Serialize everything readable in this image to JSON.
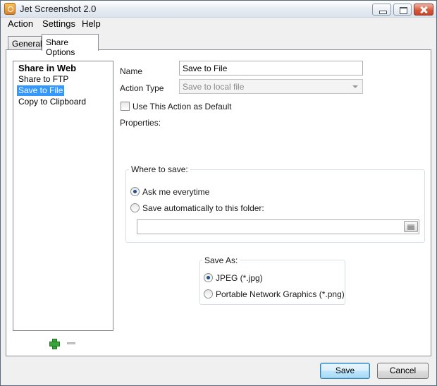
{
  "window": {
    "title": "Jet Screenshot 2.0"
  },
  "menu": [
    "Action",
    "Settings",
    "Help"
  ],
  "tabs": [
    "General",
    "Share Options"
  ],
  "actions": {
    "group_label": "Share in Web",
    "items": [
      "Share to FTP",
      "Save to File",
      "Copy to Clipboard"
    ],
    "selected": "Save to File"
  },
  "form": {
    "name_label": "Name",
    "name_value": "Save to File",
    "action_type_label": "Action Type",
    "action_type_value": "Save to local file",
    "default_checkbox_label": "Use This Action as Default",
    "properties_label": "Properties:"
  },
  "where_to_save": {
    "title": "Where to save:",
    "option_ask": "Ask me everytime",
    "option_auto": "Save automatically to this folder:",
    "selected": "Ask me everytime",
    "folder_path": ""
  },
  "save_as": {
    "title": "Save As:",
    "option_jpeg": "JPEG (*.jpg)",
    "option_png": "Portable Network Graphics (*.png)",
    "selected": "JPEG (*.jpg)"
  },
  "buttons": {
    "save": "Save",
    "cancel": "Cancel"
  }
}
